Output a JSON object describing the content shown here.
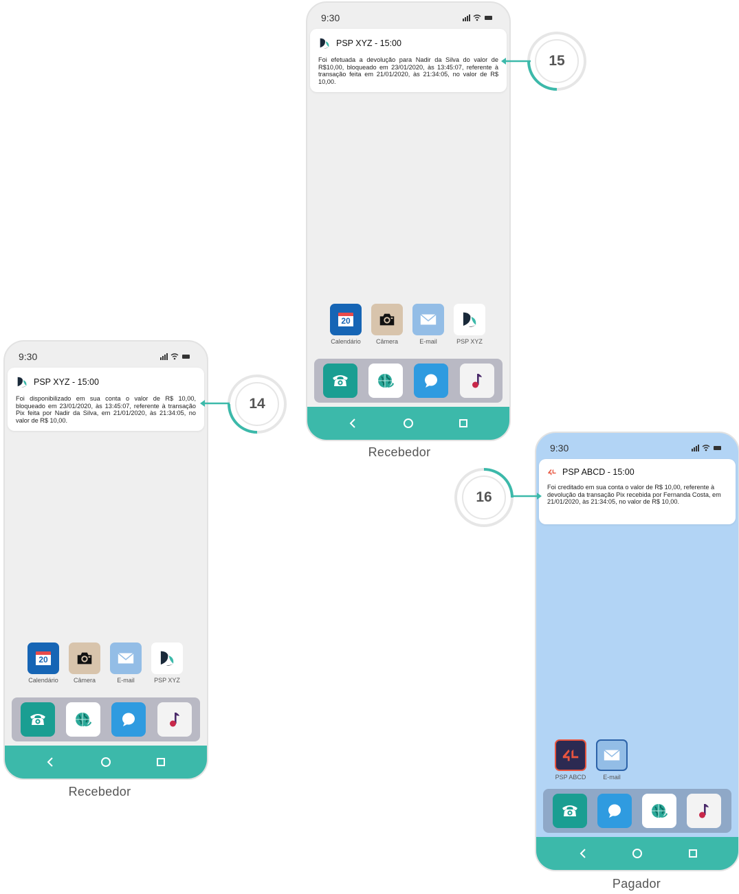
{
  "phones": {
    "p15": {
      "time": "9:30",
      "notification": {
        "title": "PSP XYZ - 15:00",
        "body": "Foi efetuada a devolução para Nadir da Silva do valor de R$10,00, bloqueado em 23/01/2020, às 13:45:07, referente à transação feita em 21/01/2020, às 21:34:05, no valor de R$ 10,00."
      },
      "calendar_day": "20",
      "apps": [
        "Calendário",
        "Câmera",
        "E-mail",
        "PSP XYZ"
      ],
      "caption": "Recebedor"
    },
    "p14": {
      "time": "9:30",
      "notification": {
        "title": "PSP XYZ - 15:00",
        "body": "Foi disponibilizado em sua conta o valor de R$ 10,00, bloqueado em 23/01/2020, às 13:45:07, referente à transação Pix feita por Nadir da Silva, em 21/01/2020, às 21:34:05, no valor de R$ 10,00."
      },
      "calendar_day": "20",
      "apps": [
        "Calendário",
        "Câmera",
        "E-mail",
        "PSP XYZ"
      ],
      "caption": "Recebedor"
    },
    "p16": {
      "time": "9:30",
      "notification": {
        "title": "PSP ABCD - 15:00",
        "body": "Foi creditado em sua conta o valor de R$ 10,00, referente à devolução da transação Pix recebida por Fernanda Costa, em 21/01/2020, às 21:34:05, no valor de R$ 10,00."
      },
      "apps": [
        "PSP ABCD",
        "E-mail"
      ],
      "caption": "Pagador"
    }
  },
  "steps": {
    "s14": "14",
    "s15": "15",
    "s16": "16"
  },
  "colors": {
    "accent": "#3cb9aa",
    "ring": "#e6e6e6"
  }
}
